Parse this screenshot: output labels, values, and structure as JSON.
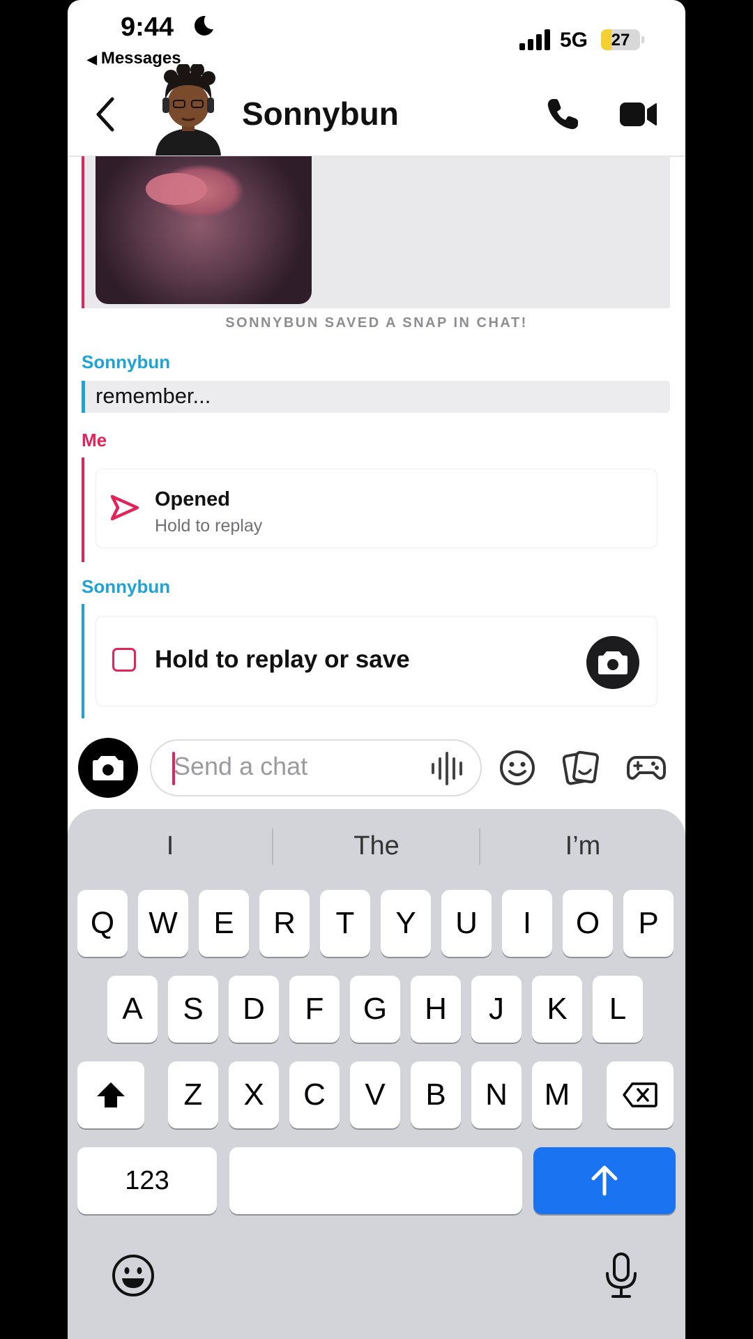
{
  "status_bar": {
    "time": "9:44",
    "back_app": "Messages",
    "network": "5G",
    "battery": "27",
    "battery_level": 0.27
  },
  "header": {
    "title": "Sonnybun"
  },
  "chat": {
    "saved_note": "SONNYBUN SAVED A SNAP IN CHAT!",
    "sender_1": "Sonnybun",
    "message_1": "remember...",
    "sender_2": "Me",
    "opened_label": "Opened",
    "opened_sub": "Hold to replay",
    "sender_3": "Sonnybun",
    "snap_label": "Hold to replay or save"
  },
  "input": {
    "placeholder": "Send a chat"
  },
  "keyboard": {
    "suggestions": [
      "I",
      "The",
      "I’m"
    ],
    "row1": [
      "Q",
      "W",
      "E",
      "R",
      "T",
      "Y",
      "U",
      "I",
      "O",
      "P"
    ],
    "row2": [
      "A",
      "S",
      "D",
      "F",
      "G",
      "H",
      "J",
      "K",
      "L"
    ],
    "row3": [
      "Z",
      "X",
      "C",
      "V",
      "B",
      "N",
      "M"
    ],
    "numbers_key": "123"
  },
  "colors": {
    "accent_red": "#e1245a",
    "accent_blue": "#1fa2d6",
    "return_key": "#1a73f0"
  },
  "icons": [
    "moon-icon",
    "signal-icon",
    "back-chevron-icon",
    "bitmoji-avatar",
    "phone-icon",
    "video-icon",
    "send-arrow-icon",
    "camera-icon",
    "voice-icon",
    "emoji-icon",
    "sticker-icon",
    "game-controller-icon",
    "shift-icon",
    "backspace-icon",
    "return-arrow-icon",
    "keyboard-emoji-icon",
    "dictation-mic-icon"
  ]
}
